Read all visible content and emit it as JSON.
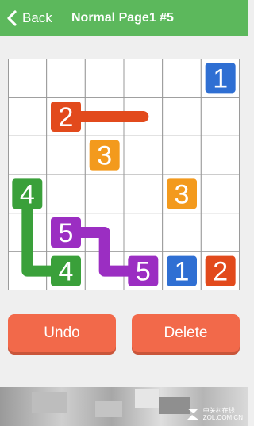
{
  "header": {
    "back_label": "Back",
    "title": "Normal Page1 #5",
    "back_icon": "chevron-left-icon"
  },
  "board": {
    "size": 6,
    "colors": {
      "blue": "#2f6fd3",
      "red": "#e24a1c",
      "orange": "#f39a1d",
      "green": "#3aa03a",
      "purple": "#9b2ec2"
    },
    "tiles": [
      {
        "num": "1",
        "color": "blue",
        "row": 0,
        "col": 5
      },
      {
        "num": "2",
        "color": "red",
        "row": 1,
        "col": 1
      },
      {
        "num": "3",
        "color": "orange",
        "row": 2,
        "col": 2
      },
      {
        "num": "4",
        "color": "green",
        "row": 3,
        "col": 0
      },
      {
        "num": "3",
        "color": "orange",
        "row": 3,
        "col": 4
      },
      {
        "num": "5",
        "color": "purple",
        "row": 4,
        "col": 1
      },
      {
        "num": "4",
        "color": "green",
        "row": 5,
        "col": 1
      },
      {
        "num": "5",
        "color": "purple",
        "row": 5,
        "col": 3
      },
      {
        "num": "1",
        "color": "blue",
        "row": 5,
        "col": 4
      },
      {
        "num": "2",
        "color": "red",
        "row": 5,
        "col": 5
      }
    ],
    "paths": [
      {
        "color": "red",
        "cells": [
          [
            1,
            1
          ],
          [
            1,
            2
          ],
          [
            1,
            3
          ]
        ]
      },
      {
        "color": "green",
        "cells": [
          [
            3,
            0
          ],
          [
            4,
            0
          ],
          [
            5,
            0
          ],
          [
            5,
            1
          ]
        ]
      },
      {
        "color": "purple",
        "cells": [
          [
            4,
            1
          ],
          [
            4,
            2
          ],
          [
            5,
            2
          ],
          [
            5,
            3
          ]
        ]
      }
    ]
  },
  "buttons": {
    "undo": "Undo",
    "delete": "Delete"
  },
  "watermark": {
    "line1": "中关村在线",
    "line2": "ZOL.COM.CN"
  }
}
